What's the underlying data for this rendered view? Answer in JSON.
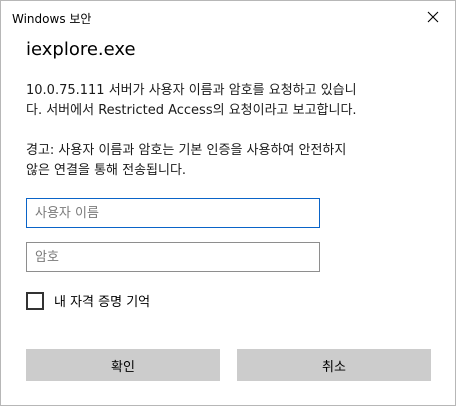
{
  "window": {
    "title": "Windows 보안"
  },
  "app_name": "iexplore.exe",
  "message": {
    "line1": "10.0.75.111 서버가 사용자 이름과 암호를 요청하고 있습니",
    "line2": "다. 서버에서 Restricted Access의 요청이라고 보고합니다."
  },
  "warning": {
    "line1": "경고: 사용자 이름과 암호는 기본 인증을 사용하여 안전하지",
    "line2": "않은 연결을 통해 전송됩니다."
  },
  "username": {
    "value": "",
    "placeholder": "사용자 이름"
  },
  "password": {
    "value": "",
    "placeholder": "암호"
  },
  "remember": {
    "label": "내 자격 증명 기억",
    "checked": false
  },
  "buttons": {
    "ok": "확인",
    "cancel": "취소"
  },
  "icons": {
    "close": "close-icon"
  }
}
